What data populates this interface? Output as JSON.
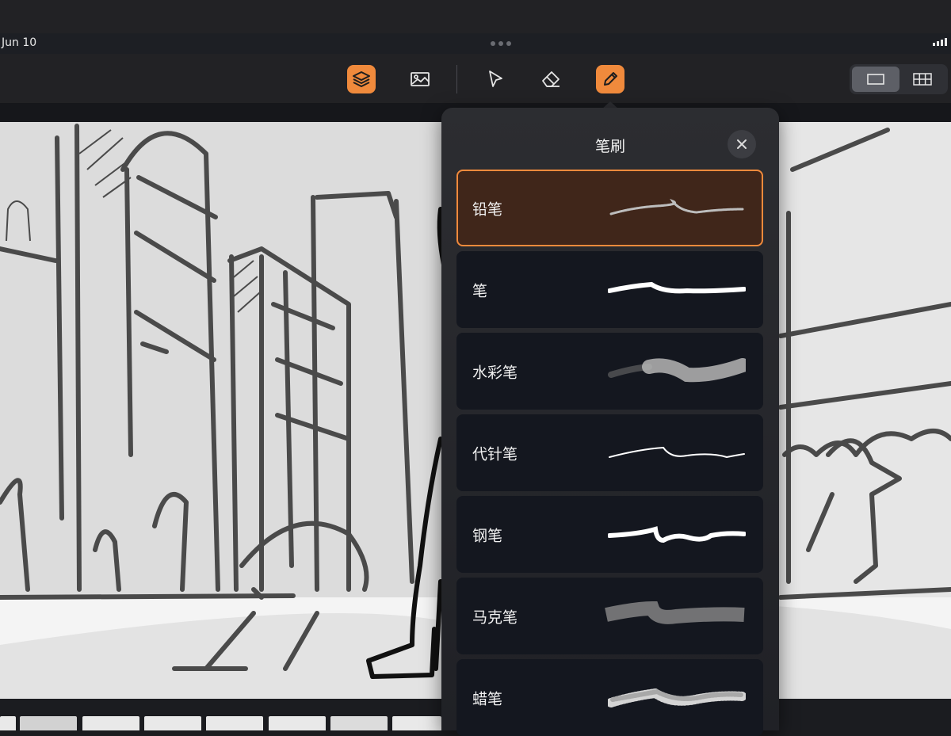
{
  "status": {
    "date": "Jun 10"
  },
  "toolbar": {
    "tools": [
      {
        "icon": "layers-icon",
        "active": true
      },
      {
        "icon": "image-icon",
        "active": false
      },
      {
        "icon": "pointer-icon",
        "active": false
      },
      {
        "icon": "eraser-icon",
        "active": false
      },
      {
        "icon": "pencil-icon",
        "active": true
      }
    ],
    "view_modes": [
      {
        "icon": "single-frame-icon",
        "selected": true
      },
      {
        "icon": "grid-view-icon",
        "selected": false
      }
    ]
  },
  "brush_panel": {
    "title": "笔刷",
    "close_icon": "close-icon",
    "brushes": [
      {
        "label": "铅笔",
        "selected": true
      },
      {
        "label": "笔",
        "selected": false
      },
      {
        "label": "水彩笔",
        "selected": false
      },
      {
        "label": "代针笔",
        "selected": false
      },
      {
        "label": "钢笔",
        "selected": false
      },
      {
        "label": "马克笔",
        "selected": false
      },
      {
        "label": "蜡笔",
        "selected": false
      }
    ]
  },
  "colors": {
    "accent": "#f08a3c",
    "selected_fill": "#40261a",
    "panel": "#2c2d31",
    "row": "#14171f"
  }
}
